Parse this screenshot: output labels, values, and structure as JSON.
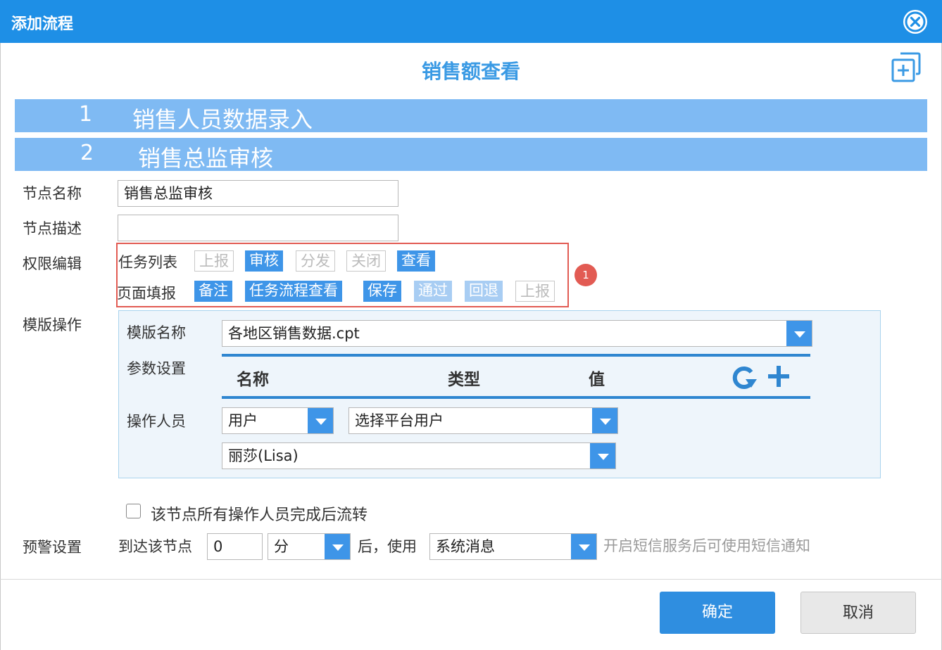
{
  "window": {
    "title": "添加流程"
  },
  "flow": {
    "name": "销售额查看"
  },
  "nodes": [
    {
      "num": "1",
      "name": "销售人员数据录入"
    },
    {
      "num": "2",
      "name": "销售总监审核"
    }
  ],
  "form": {
    "node_name_label": "节点名称",
    "node_name_value": "销售总监审核",
    "node_desc_label": "节点描述",
    "node_desc_value": "",
    "perm_label": "权限编辑",
    "task_list_label": "任务列表",
    "task_list_tags": [
      {
        "label": "上报",
        "state": "off"
      },
      {
        "label": "审核",
        "state": "on"
      },
      {
        "label": "分发",
        "state": "off"
      },
      {
        "label": "关闭",
        "state": "off"
      },
      {
        "label": "查看",
        "state": "on"
      }
    ],
    "page_fill_label": "页面填报",
    "page_fill_tags": [
      {
        "label": "备注",
        "state": "on"
      },
      {
        "label": "任务流程查看",
        "state": "on"
      },
      {
        "label": "保存",
        "state": "on"
      },
      {
        "label": "通过",
        "state": "dim"
      },
      {
        "label": "回退",
        "state": "dim"
      },
      {
        "label": "上报",
        "state": "off"
      }
    ],
    "badge": "1",
    "template_label": "模版操作"
  },
  "template": {
    "name_label": "模版名称",
    "name_value": "各地区销售数据.cpt",
    "param_label": "参数设置",
    "param_headers": {
      "name": "名称",
      "type": "类型",
      "value": "值"
    },
    "operator_label": "操作人员",
    "operator_type": "用户",
    "operator_source": "选择平台用户",
    "operator_user": "丽莎(Lisa)"
  },
  "flow_option": {
    "label": "该节点所有操作人员完成后流转",
    "checked": false
  },
  "alert": {
    "label": "预警设置",
    "prefix": "到达该节点",
    "value": "0",
    "unit": "分",
    "middle": "后，使用",
    "method": "系统消息",
    "hint": "开启短信服务后可使用短信通知"
  },
  "buttons": {
    "ok": "确定",
    "cancel": "取消"
  },
  "colors": {
    "titlebar": "#1e8fe6",
    "node_bar": "#7fbaf3",
    "accent": "#3e95e8",
    "highlight": "#e25b53"
  }
}
